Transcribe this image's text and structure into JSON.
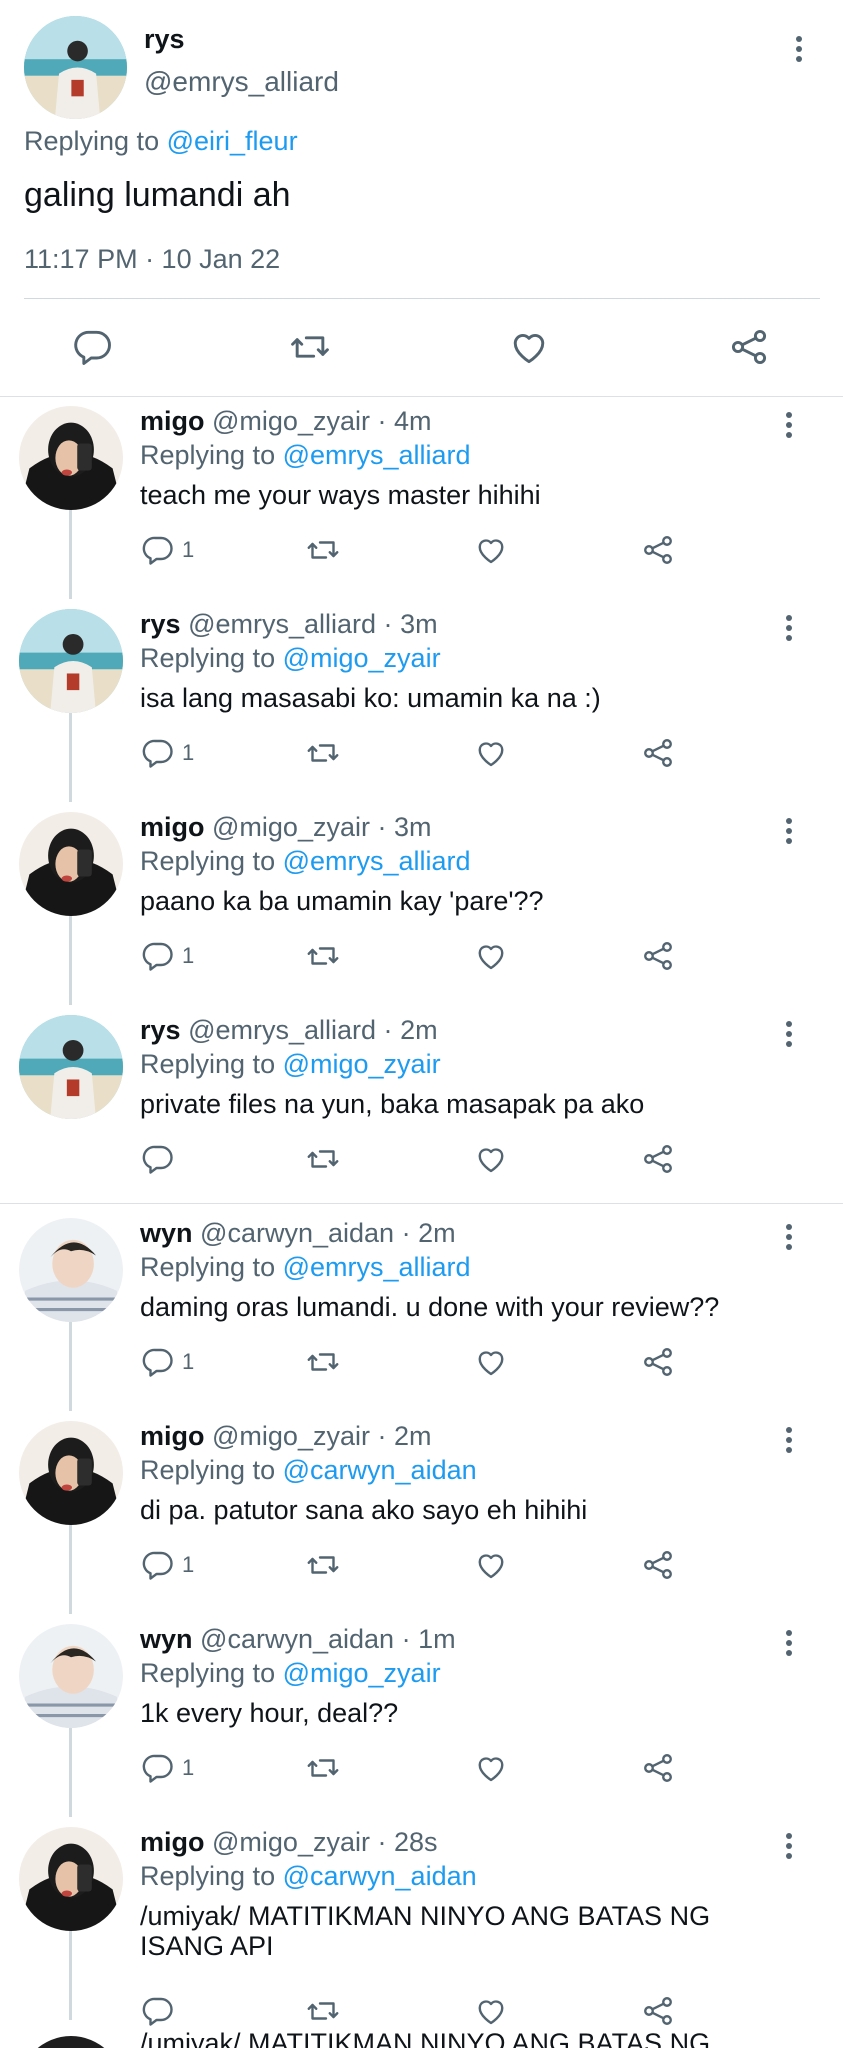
{
  "main_tweet": {
    "name": "rys",
    "handle": "@emrys_alliard",
    "replying_label": "Replying to",
    "replying_to": "@eiri_fleur",
    "text": "galing lumandi ah",
    "timestamp": "11:17 PM · 10 Jan 22"
  },
  "replies": [
    {
      "name": "migo",
      "handle": "@migo_zyair",
      "time": "4m",
      "replying_label": "Replying to",
      "replying_to": "@emrys_alliard",
      "text": "teach me your ways master hihihi",
      "reply_count": "1"
    },
    {
      "name": "rys",
      "handle": "@emrys_alliard",
      "time": "3m",
      "replying_label": "Replying to",
      "replying_to": "@migo_zyair",
      "text": "isa lang masasabi ko: umamin ka na :)",
      "reply_count": "1"
    },
    {
      "name": "migo",
      "handle": "@migo_zyair",
      "time": "3m",
      "replying_label": "Replying to",
      "replying_to": "@emrys_alliard",
      "text": "paano ka ba umamin kay 'pare'??",
      "reply_count": "1"
    },
    {
      "name": "rys",
      "handle": "@emrys_alliard",
      "time": "2m",
      "replying_label": "Replying to",
      "replying_to": "@migo_zyair",
      "text": "private files na yun, baka masapak pa ako",
      "reply_count": ""
    },
    {
      "name": "wyn",
      "handle": "@carwyn_aidan",
      "time": "2m",
      "replying_label": "Replying to",
      "replying_to": "@emrys_alliard",
      "text": "daming oras lumandi. u done with your review??",
      "reply_count": "1"
    },
    {
      "name": "migo",
      "handle": "@migo_zyair",
      "time": "2m",
      "replying_label": "Replying to",
      "replying_to": "@carwyn_aidan",
      "text": "di pa. patutor sana ako sayo eh hihihi",
      "reply_count": "1"
    },
    {
      "name": "wyn",
      "handle": "@carwyn_aidan",
      "time": "1m",
      "replying_label": "Replying to",
      "replying_to": "@migo_zyair",
      "text": "1k every hour, deal??",
      "reply_count": "1"
    },
    {
      "name": "migo",
      "handle": "@migo_zyair",
      "time": "28s",
      "replying_label": "Replying to",
      "replying_to": "@carwyn_aidan",
      "text": "/umiyak/ MATITIKMAN NINYO ANG BATAS NG ISANG API",
      "reply_count": ""
    }
  ],
  "peek_text": "/umiyak/ MATITIKMAN NINYO ANG BATAS NG",
  "colors": {
    "link": "#1d9bf0",
    "muted": "#536471",
    "divider": "#cfd9de"
  }
}
